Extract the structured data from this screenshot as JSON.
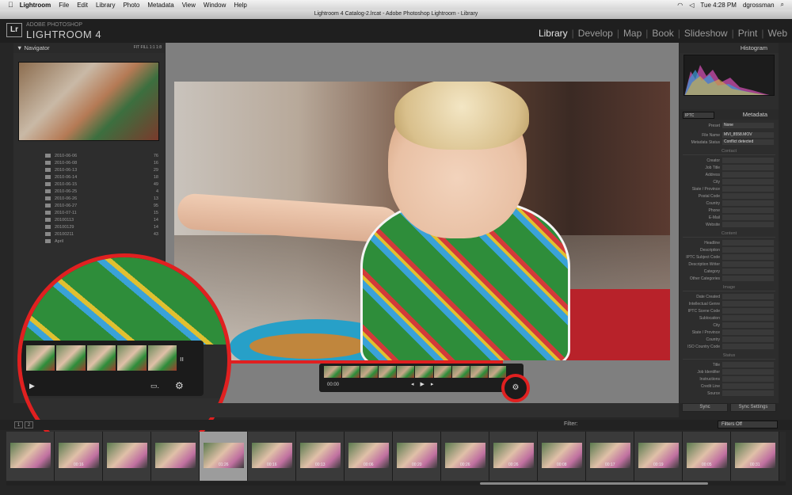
{
  "menubar": {
    "apple_icon": "apple-icon",
    "app": "Lightroom",
    "items": [
      "File",
      "Edit",
      "Library",
      "Photo",
      "Metadata",
      "View",
      "Window",
      "Help"
    ],
    "clock": "Tue 4:28 PM",
    "user": "dgrossman"
  },
  "window_title": "Lightroom 4 Catalog-2.lrcat - Adobe Photoshop Lightroom - Library",
  "header": {
    "logo": "Lr",
    "brand_small": "ADOBE PHOTOSHOP",
    "brand": "LIGHTROOM 4",
    "modules": [
      "Library",
      "Develop",
      "Map",
      "Book",
      "Slideshow",
      "Print",
      "Web"
    ],
    "active_module": "Library"
  },
  "navigator": {
    "title": "Navigator",
    "zoom_options": [
      "FIT",
      "FILL",
      "1:1",
      "1:8"
    ]
  },
  "folders": [
    {
      "name": "2010-06-06",
      "count": "76"
    },
    {
      "name": "2010-06-08",
      "count": "16"
    },
    {
      "name": "2010-06-13",
      "count": "29"
    },
    {
      "name": "2010-06-14",
      "count": "18"
    },
    {
      "name": "2010-06-15",
      "count": "49"
    },
    {
      "name": "2010-06-25",
      "count": "4"
    },
    {
      "name": "2010-06-26",
      "count": "13"
    },
    {
      "name": "2010-06-27",
      "count": "95"
    },
    {
      "name": "2010-07-11",
      "count": "15"
    },
    {
      "name": "20100113",
      "count": "14"
    },
    {
      "name": "20100129",
      "count": "14"
    },
    {
      "name": "20100211",
      "count": "43"
    },
    {
      "name": "April",
      "count": ""
    }
  ],
  "histogram": {
    "title": "Histogram"
  },
  "metadata": {
    "title": "Metadata",
    "preset_dropdown": "IPTC",
    "preset_label": "Preset",
    "preset_value": "None",
    "file_name_label": "File Name",
    "file_name": "MVI_8558.MOV",
    "status_label": "Metadata Status",
    "status_value": "Conflict detected",
    "contact_title": "Contact",
    "contact_fields": [
      "Creator",
      "Job Title",
      "Address",
      "City",
      "State / Province",
      "Postal Code",
      "Country",
      "Phone",
      "E-Mail",
      "Website"
    ],
    "content_title": "Content",
    "content_fields": [
      "Headline",
      "Description",
      "IPTC Subject Code",
      "Description Writer",
      "Category",
      "Other Categories"
    ],
    "image_title": "Image",
    "image_fields": [
      "Date Created",
      "Intellectual Genre",
      "IPTC Scene Code",
      "Sublocation",
      "City",
      "State / Province",
      "Country",
      "ISO Country Code"
    ],
    "status_title": "Status",
    "status_fields": [
      "Title",
      "Job Identifier",
      "Instructions",
      "Credit Line",
      "Source"
    ]
  },
  "sync": {
    "sync": "Sync",
    "sync_settings": "Sync Settings"
  },
  "video": {
    "time": "00:00",
    "prev": "◂",
    "play": "▶",
    "next": "▸",
    "gear_icon": "gear-icon"
  },
  "zoom_callout": {
    "play": "▶",
    "pause": "ıı",
    "frame": "▭.",
    "gear": "⚙"
  },
  "filmstrip_bar": {
    "page1": "1",
    "page2": "2",
    "filter_label": "Filter:",
    "filter_value": "Filters Off"
  },
  "filmstrip": [
    {
      "dur": "",
      "selected": false
    },
    {
      "dur": "00:16",
      "selected": false
    },
    {
      "dur": "",
      "selected": false
    },
    {
      "dur": "",
      "selected": false
    },
    {
      "dur": "01:26",
      "selected": true
    },
    {
      "dur": "00:16",
      "selected": false
    },
    {
      "dur": "00:13",
      "selected": false
    },
    {
      "dur": "00:06",
      "selected": false
    },
    {
      "dur": "00:20",
      "selected": false
    },
    {
      "dur": "00:26",
      "selected": false
    },
    {
      "dur": "00:26",
      "selected": false
    },
    {
      "dur": "00:08",
      "selected": false
    },
    {
      "dur": "00:17",
      "selected": false
    },
    {
      "dur": "00:19",
      "selected": false
    },
    {
      "dur": "00:05",
      "selected": false
    },
    {
      "dur": "00:31",
      "selected": false
    }
  ]
}
